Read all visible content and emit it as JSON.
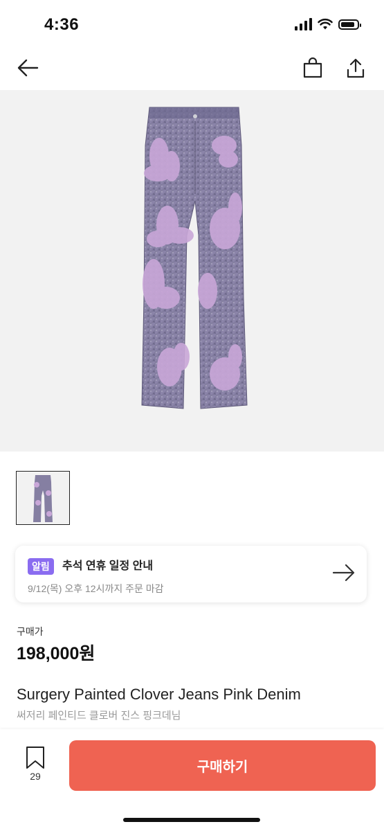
{
  "status_bar": {
    "time": "4:36",
    "battery_level": 0.85
  },
  "nav": {
    "back_icon": "arrow-left-icon",
    "bag_icon": "shopping-bag-icon",
    "share_icon": "share-icon"
  },
  "product": {
    "image_description_icon": "jeans-photo",
    "price_label": "구매가",
    "price": "198,000원",
    "name_en": "Surgery Painted Clover Jeans Pink Denim",
    "name_ko": "써저리 페인티드 클로버 진스 핑크데님"
  },
  "notice": {
    "badge": "알림",
    "title": "추석 연휴 일정 안내",
    "subtitle": "9/12(목) 오후 12시까지 주문 마감"
  },
  "bottom_bar": {
    "like_count": "29",
    "buy_label": "구매하기"
  },
  "colors": {
    "accent": "#ef6352",
    "badge": "#8a6cf0"
  }
}
